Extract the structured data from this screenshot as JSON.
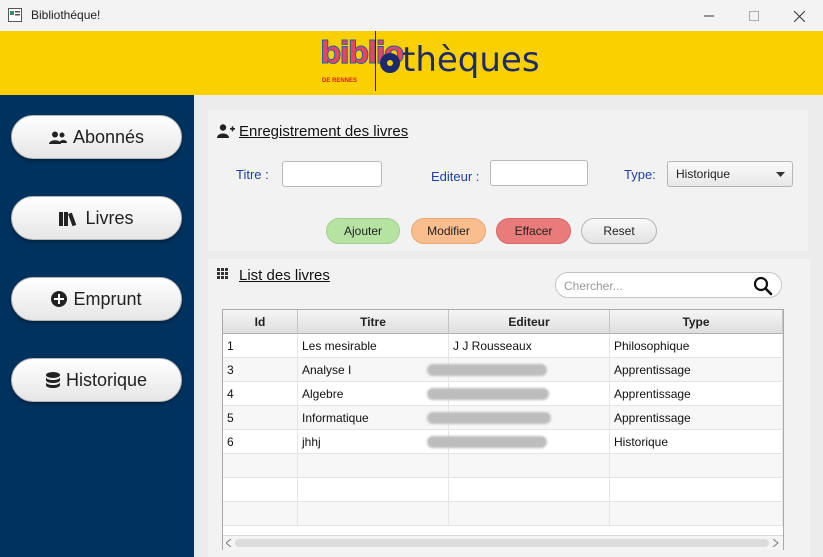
{
  "window": {
    "title": "Bibliothéque!"
  },
  "colors": {
    "banner": "#fbd000",
    "sidebar": "#00325f",
    "add": "#b7e3a2",
    "modify": "#f9bd8e",
    "clear": "#ea7b7b"
  },
  "banner": {
    "logo_part1": "biblio",
    "logo_part2": "thèques",
    "logo_sub": "DE RENNES"
  },
  "sidebar": {
    "items": [
      {
        "label": "Abonnés",
        "icon": "users-icon"
      },
      {
        "label": "Livres",
        "icon": "books-icon"
      },
      {
        "label": "Emprunt",
        "icon": "plus-circle-icon"
      },
      {
        "label": "Historique",
        "icon": "database-icon"
      }
    ]
  },
  "form": {
    "title": "Enregistrement des livres",
    "titre_label": "Titre :",
    "titre_value": "",
    "editeur_label": "Editeur :",
    "editeur_value": "",
    "type_label": "Type:",
    "type_value": "Historique",
    "buttons": {
      "add": "Ajouter",
      "modify": "Modifier",
      "clear": "Effacer",
      "reset": "Reset"
    }
  },
  "list": {
    "title": "List des livres",
    "search_placeholder": "Chercher...",
    "columns": [
      "Id",
      "Titre",
      "Editeur",
      "Type"
    ],
    "rows": [
      {
        "id": "1",
        "titre": "Les mesirable",
        "editeur": "J J Rousseaux",
        "type": "Philosophique"
      },
      {
        "id": "3",
        "titre": "Analyse I",
        "editeur": "",
        "type": "Apprentissage"
      },
      {
        "id": "4",
        "titre": "Algebre",
        "editeur": "",
        "type": "Apprentissage"
      },
      {
        "id": "5",
        "titre": "Informatique",
        "editeur": "",
        "type": "Apprentissage"
      },
      {
        "id": "6",
        "titre": "jhhj",
        "editeur": "",
        "type": "Historique"
      }
    ]
  }
}
